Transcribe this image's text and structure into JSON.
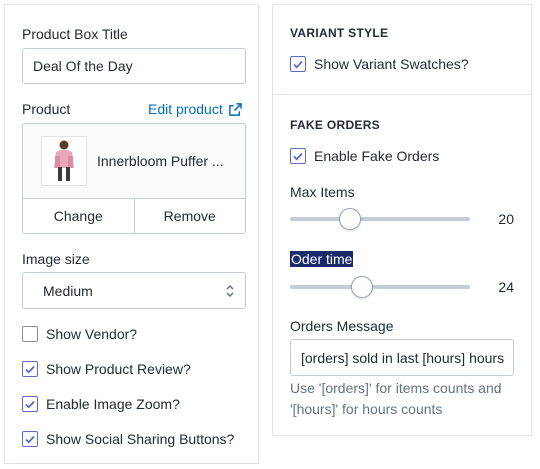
{
  "left": {
    "title_label": "Product Box Title",
    "title_value": "Deal Of the Day",
    "product_label": "Product",
    "edit_link": "Edit product",
    "product_name": "Innerbloom Puffer ...",
    "change_button": "Change",
    "remove_button": "Remove",
    "image_size_label": "Image size",
    "image_size_value": "Medium",
    "checkboxes": [
      {
        "label": "Show Vendor?",
        "checked": false
      },
      {
        "label": "Show Product Review?",
        "checked": true
      },
      {
        "label": "Enable Image Zoom?",
        "checked": true
      },
      {
        "label": "Show Social Sharing Buttons?",
        "checked": true
      }
    ]
  },
  "right": {
    "variant_heading": "VARIANT STYLE",
    "variant_swatches": {
      "label": "Show Variant Swatches?",
      "checked": true
    },
    "fake_heading": "FAKE ORDERS",
    "enable_fake": {
      "label": "Enable Fake Orders",
      "checked": true
    },
    "max_items_label": "Max Items",
    "max_items": {
      "value": "20",
      "min": 0,
      "max": 60,
      "level": 20
    },
    "order_time_label": "Oder time",
    "order_time": {
      "value": "24",
      "min": 0,
      "max": 60,
      "level": 24
    },
    "message_label": "Orders Message",
    "message_value": "[orders] sold in last [hours] hours",
    "help_text": "Use '[orders]' for items counts and '[hours]' for hours counts"
  },
  "colors": {
    "accent": "#5c6ac4",
    "link": "#006fbb",
    "highlight": "#1b2a6b"
  }
}
